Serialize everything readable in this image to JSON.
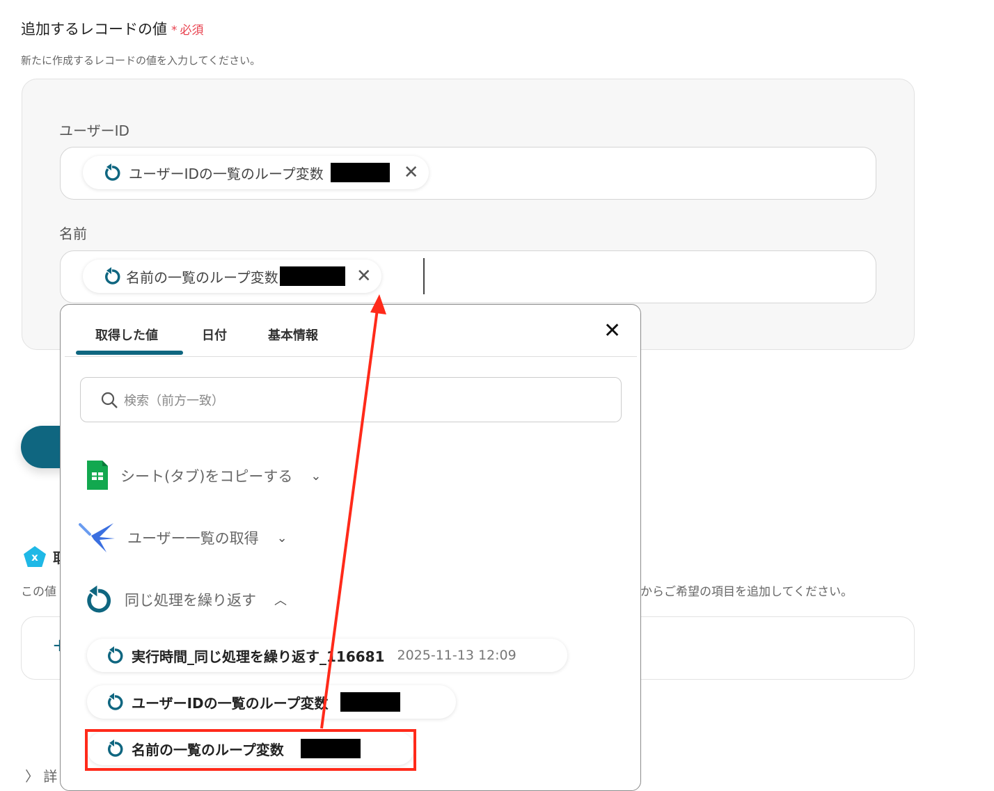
{
  "section": {
    "title": "追加するレコードの値",
    "required_mark": "*",
    "required_label": "必須",
    "description": "新たに作成するレコードの値を入力してください。"
  },
  "fields": [
    {
      "label": "ユーザーID",
      "chip": "ユーザーIDの一覧のループ変数"
    },
    {
      "label": "名前",
      "chip": "名前の一覧のループ変数"
    }
  ],
  "background": {
    "hint_prefix": "この値",
    "hint_suffix": "からご希望の項目を追加してください。",
    "add_symbol": "+",
    "details": "詳",
    "section_initial": "取"
  },
  "popup": {
    "tabs": [
      "取得した値",
      "日付",
      "基本情報"
    ],
    "active_tab": 0,
    "search_placeholder": "検索（前方一致）",
    "groups": [
      {
        "label": "シート(タブ)をコピーする",
        "icon": "google-sheets-icon",
        "expanded": false
      },
      {
        "label": "ユーザー一覧の取得",
        "icon": "app-bird-icon",
        "expanded": false
      },
      {
        "label": "同じ処理を繰り返す",
        "icon": "loop-icon",
        "expanded": true
      }
    ],
    "items": [
      {
        "label": "実行時間_同じ処理を繰り返す_116681",
        "value": "2025-11-13 12:09"
      },
      {
        "label": "ユーザーIDの一覧のループ変数"
      },
      {
        "label": "名前の一覧のループ変数"
      }
    ]
  },
  "colors": {
    "accent": "#0f6680",
    "required": "#e8424f",
    "annotation": "#ff2a1a"
  }
}
